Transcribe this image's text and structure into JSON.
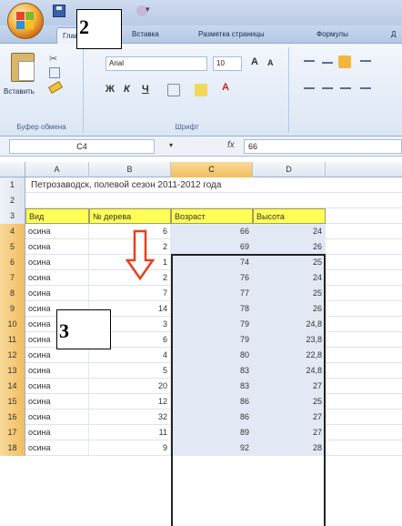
{
  "ribbon": {
    "tabs": [
      "Главная",
      "Вставка",
      "Разметка страницы",
      "Формулы",
      "Д"
    ],
    "clipboard": {
      "paste_label": "Вставить",
      "group_label": "Буфер обмена"
    },
    "font": {
      "name": "Arial",
      "size": "10",
      "group_label": "Шрифт"
    }
  },
  "formula_bar": {
    "name_box": "C4",
    "formula": "66",
    "fx_label": "fx"
  },
  "columns": [
    "A",
    "B",
    "C",
    "D"
  ],
  "sheet": {
    "title": "Петрозаводск, полевой сезон 2011-2012 года",
    "headers": [
      "Вид",
      "№ дерева",
      "Возраст",
      "Высота"
    ],
    "rows": [
      {
        "num": "4",
        "a": "осина",
        "b": "6",
        "c": "66",
        "d": "24"
      },
      {
        "num": "5",
        "a": "осина",
        "b": "2",
        "c": "69",
        "d": "26"
      },
      {
        "num": "6",
        "a": "осина",
        "b": "1",
        "c": "74",
        "d": "25"
      },
      {
        "num": "7",
        "a": "осина",
        "b": "2",
        "c": "76",
        "d": "24"
      },
      {
        "num": "8",
        "a": "осина",
        "b": "7",
        "c": "77",
        "d": "25"
      },
      {
        "num": "9",
        "a": "осина",
        "b": "14",
        "c": "78",
        "d": "26"
      },
      {
        "num": "10",
        "a": "осина",
        "b": "3",
        "c": "79",
        "d": "24,8"
      },
      {
        "num": "11",
        "a": "осина",
        "b": "6",
        "c": "79",
        "d": "23,8"
      },
      {
        "num": "12",
        "a": "осина",
        "b": "4",
        "c": "80",
        "d": "22,8"
      },
      {
        "num": "13",
        "a": "осина",
        "b": "5",
        "c": "83",
        "d": "24,8"
      },
      {
        "num": "14",
        "a": "осина",
        "b": "20",
        "c": "83",
        "d": "27"
      },
      {
        "num": "15",
        "a": "осина",
        "b": "12",
        "c": "86",
        "d": "25"
      },
      {
        "num": "16",
        "a": "осина",
        "b": "32",
        "c": "86",
        "d": "27"
      },
      {
        "num": "17",
        "a": "осина",
        "b": "11",
        "c": "89",
        "d": "27"
      },
      {
        "num": "18",
        "a": "осина",
        "b": "9",
        "c": "92",
        "d": "28"
      }
    ]
  },
  "callouts": {
    "c2": "2",
    "c3": "3"
  },
  "colors": {
    "header_fill": "#ffff55",
    "selection": "#f2bd5d",
    "arrow": "#e8401c"
  }
}
